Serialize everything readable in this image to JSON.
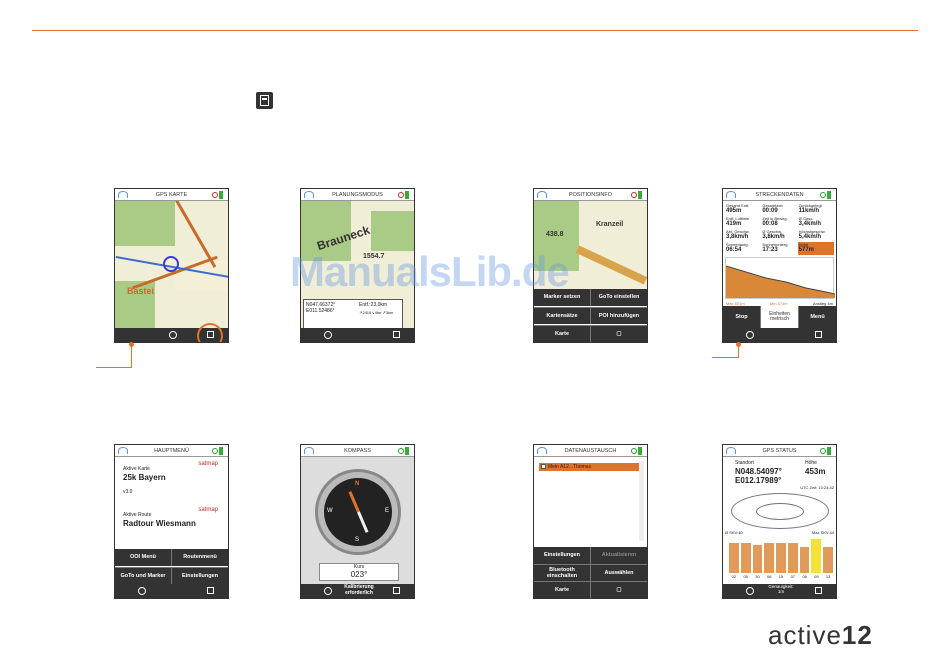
{
  "watermark": "ManualsLib.de",
  "logo": {
    "light": "active",
    "bold": "12"
  },
  "screens": {
    "gps_map": {
      "title": "GPS KARTE",
      "label": "Bastei"
    },
    "planning": {
      "title": "PLANUNGSMODUS",
      "place": "Brauneck",
      "height": "1554.7",
      "coords": "N047.66372°\nE011.52486°",
      "dist": "Entf.:23,0km",
      "dist_sub": "↗2416↘4he ↗3km"
    },
    "position": {
      "title": "POSITIONSINFO",
      "place": "Kranzeil",
      "height": "438.8",
      "buttons": [
        "Marker setzen",
        "GoTo einstellen",
        "Kartensätze",
        "POI hinzufügen",
        "Karte",
        ""
      ]
    },
    "track": {
      "title": "STRECKENDATEN",
      "cells": [
        [
          "Gesamt Entf.",
          "495m"
        ],
        [
          "Gesamtzeit",
          "00:09"
        ],
        [
          "Zurückgelegt",
          "11km/h"
        ],
        [
          "Entf. Luftlinie",
          "419m"
        ],
        [
          "Zeit in Beweg.",
          "00:08"
        ],
        [
          "Ø Gesc.",
          "3,4km/h"
        ],
        [
          "Abt. Geschw.",
          "3,8km/h"
        ],
        [
          "Ø Geschw.",
          "3,8km/h"
        ],
        [
          "Höchstgeschw.",
          "5,4km/h"
        ],
        [
          "Sonnenaufg.",
          "06:54"
        ],
        [
          "Sonnenunterg.",
          "17:23"
        ],
        [
          "Höhe",
          "577m"
        ]
      ],
      "axis": [
        "Max.601m",
        "Min.574m",
        "Anstieg 4m"
      ],
      "buttons": [
        "Stop",
        "Einheiten metrisch",
        "Menü"
      ]
    },
    "main_menu": {
      "title": "HAUPTMENÜ",
      "map_label": "Aktive Karte",
      "map": "25k Bayern",
      "version": "v3.0",
      "route_label": "Aktive Route",
      "route": "Radtour Wiesmann",
      "brand": "satmap",
      "buttons": [
        "OOI Menü",
        "Routenmenü",
        "GoTo und Marker",
        "Einstellungen"
      ]
    },
    "compass": {
      "title": "KOMPASS",
      "kurs_label": "Kurs",
      "kurs": "023°",
      "calib": "Kalibrierung erforderlich",
      "dirs": [
        "N",
        "E",
        "S",
        "W"
      ]
    },
    "data": {
      "title": "DATENAUSTAUSCH",
      "item": "Mein A12...Thomas",
      "buttons": [
        "Einstellungen",
        "Aktualisieren",
        "Bluetooth einschalten",
        "Auswählen",
        "Karte",
        ""
      ]
    },
    "gps": {
      "title": "GPS STATUS",
      "pos_label": "Standort",
      "lat": "N048.54097°",
      "lon": "E012.17989°",
      "alt_label": "Höhe",
      "alt": "453m",
      "utc": "UTC Zeit: 10:24:42",
      "min_label": "Ø SKV:40",
      "max_label": "Max SKV:44",
      "sats": [
        "02",
        "05",
        "30",
        "06",
        "15",
        "07",
        "08",
        "09",
        "13"
      ],
      "acc": "Genauigkeit:",
      "acc_val": "1m"
    }
  }
}
